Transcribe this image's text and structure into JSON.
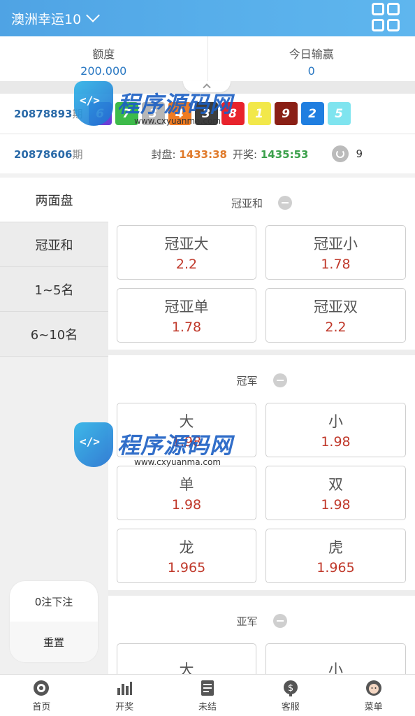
{
  "header": {
    "title": "澳洲幸运10"
  },
  "balance": {
    "amount_label": "额度",
    "amount_value": "200.000",
    "today_label": "今日输赢",
    "today_value": "0"
  },
  "draw_current": {
    "issue": "20878893",
    "suffix": "期",
    "balls": [
      {
        "n": "6",
        "color": "#6b3fd6"
      },
      {
        "n": "7",
        "color": "#3dbb4a"
      },
      {
        "n": "3",
        "color": "#b7b7b7"
      },
      {
        "n": "4",
        "color": "#ef7b22"
      },
      {
        "n": "3",
        "color": "#3d3d3d"
      },
      {
        "n": "8",
        "color": "#e8232c"
      },
      {
        "n": "1",
        "color": "#f2e84a"
      },
      {
        "n": "9",
        "color": "#8a1f15"
      },
      {
        "n": "2",
        "color": "#1f7ee0"
      },
      {
        "n": "5",
        "color": "#7fe4ef"
      }
    ]
  },
  "draw_next": {
    "issue": "20878606",
    "suffix": "期",
    "close_label": "封盘:",
    "close_time": "1433:38",
    "open_label": "开奖:",
    "open_time": "1435:53",
    "count": "9"
  },
  "sidebar": {
    "items": [
      "两面盘",
      "冠亚和",
      "1~5名",
      "6~10名"
    ],
    "bet_count": "0注下注",
    "reset": "重置"
  },
  "sections": [
    {
      "title": "冠亚和",
      "cells": [
        {
          "name": "冠亚大",
          "odd": "2.2"
        },
        {
          "name": "冠亚小",
          "odd": "1.78"
        },
        {
          "name": "冠亚单",
          "odd": "1.78"
        },
        {
          "name": "冠亚双",
          "odd": "2.2"
        }
      ]
    },
    {
      "title": "冠军",
      "cells": [
        {
          "name": "大",
          "odd": "1.98"
        },
        {
          "name": "小",
          "odd": "1.98"
        },
        {
          "name": "单",
          "odd": "1.98"
        },
        {
          "name": "双",
          "odd": "1.98"
        },
        {
          "name": "龙",
          "odd": "1.965"
        },
        {
          "name": "虎",
          "odd": "1.965"
        }
      ]
    },
    {
      "title": "亚军",
      "cells": [
        {
          "name": "大",
          "odd": ""
        },
        {
          "name": "小",
          "odd": ""
        }
      ]
    }
  ],
  "bottom_nav": [
    {
      "label": "首页",
      "icon": "home-chip-icon"
    },
    {
      "label": "开奖",
      "icon": "bar-chart-icon"
    },
    {
      "label": "未结",
      "icon": "unsettled-list-icon"
    },
    {
      "label": "客服",
      "icon": "service-dollar-icon"
    },
    {
      "label": "菜单",
      "icon": "avatar-icon"
    }
  ],
  "watermark": {
    "text": "程序源码网",
    "url": "www.cxyuanma.com"
  },
  "colors": {
    "accent": "#4fa3e4",
    "odd_red": "#c0392b",
    "issue_blue": "#2a6aa8"
  }
}
